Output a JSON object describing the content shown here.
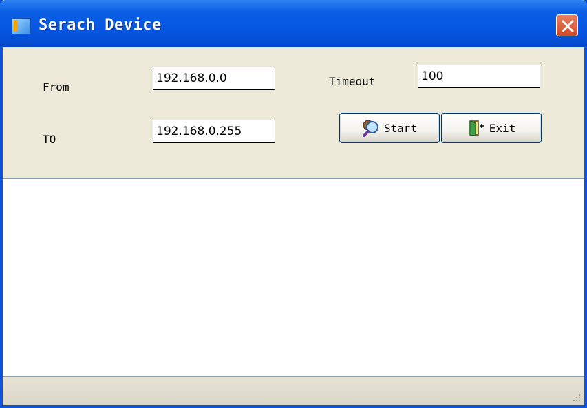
{
  "window": {
    "title": "Serach Device",
    "close_icon": "close-icon"
  },
  "form": {
    "from_label": "From",
    "from_value": "192.168.0.0",
    "to_label": "TO",
    "to_value": "192.168.0.255",
    "timeout_label": "Timeout",
    "timeout_value": "100"
  },
  "buttons": {
    "start_label": "Start",
    "start_icon": "search-magnifier-icon",
    "exit_label": "Exit",
    "exit_icon": "door-exit-icon"
  },
  "colors": {
    "titlebar": "#0554e0",
    "panel": "#ece9d8",
    "close": "#d24a28"
  }
}
